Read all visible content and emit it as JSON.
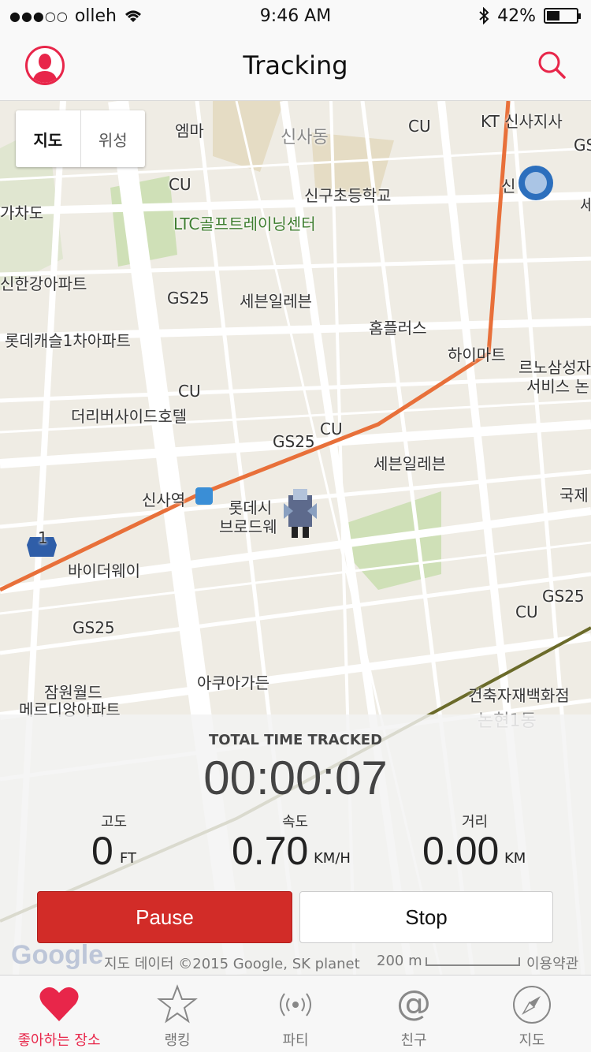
{
  "status_bar": {
    "carrier": "olleh",
    "signal_dots": "●●●○○",
    "time": "9:46 AM",
    "battery": "42%"
  },
  "nav": {
    "title": "Tracking"
  },
  "map": {
    "toggle_map": "지도",
    "toggle_satellite": "위성",
    "labels": {
      "emma": "엠마",
      "sinsadong": "신사동",
      "cu_top": "CU",
      "kt": "KT 신사지사",
      "gs_edge": "GS",
      "cu_left": "CU",
      "sinsa_school": "신구초등학교",
      "gachado": "가차도",
      "ltc": "LTC골프트레이닝센터",
      "shin_edge": "신",
      "se_edge": "세",
      "shinhan": "신한강아파트",
      "gs25_a": "GS25",
      "seven_a": "세븐일레븐",
      "homeplus": "홈플러스",
      "lotte_castle": "롯데캐슬1차아파트",
      "himart": "하이마트",
      "renault": "르노삼성자",
      "renault2": "서비스 논",
      "cu_mid": "CU",
      "hotel": "더리버사이드호텔",
      "gs25_b": "GS25",
      "cu_c": "CU",
      "seven_b": "세븐일레븐",
      "sinsa_station": "신사역",
      "lotte_cinema": "롯데시",
      "broad": "브로드웨",
      "gukje": "국제",
      "broadway": "바이더웨이",
      "gs25_c": "GS25",
      "cu_d": "CU",
      "gs25_d": "GS25",
      "jamwon": "잠원월드",
      "meridian": "메르디앙아파트",
      "aqua": "아쿠아가든",
      "building": "건축자재백화점",
      "nonhyeon": "논현1동",
      "route_badge": "1"
    }
  },
  "tracking": {
    "total_label": "TOTAL TIME TRACKED",
    "elapsed": "00:00:07",
    "altitude_label": "고도",
    "altitude_value": "0",
    "altitude_unit": "FT",
    "speed_label": "속도",
    "speed_value": "0.70",
    "speed_unit": "KM/H",
    "distance_label": "거리",
    "distance_value": "0.00",
    "distance_unit": "KM",
    "pause_label": "Pause",
    "stop_label": "Stop"
  },
  "map_footer": {
    "google": "Google",
    "attribution": "지도 데이터 ©2015 Google, SK planet",
    "scale": "200 m",
    "terms": "이용약관"
  },
  "tabs": [
    {
      "label": "좋아하는 장소",
      "icon": "heart-icon"
    },
    {
      "label": "랭킹",
      "icon": "star-icon"
    },
    {
      "label": "파티",
      "icon": "broadcast-icon"
    },
    {
      "label": "친구",
      "icon": "at-icon"
    },
    {
      "label": "지도",
      "icon": "compass-icon"
    }
  ],
  "colors": {
    "accent": "#e8264a",
    "pause": "#d22c28",
    "route": "#e8703a"
  }
}
